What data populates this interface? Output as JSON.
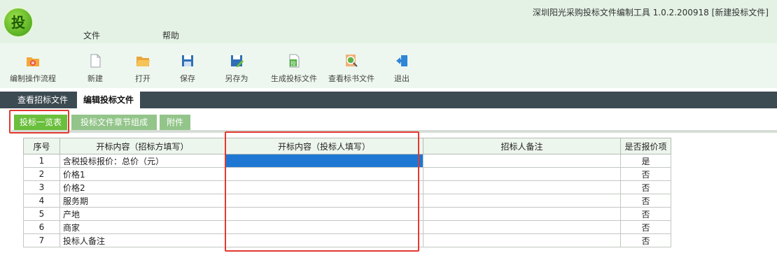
{
  "app": {
    "title": "深圳阳光采购投标文件编制工具 1.0.2.200918 [新建投标文件]",
    "logo_char": "投"
  },
  "menu": {
    "file": "文件",
    "help": "帮助"
  },
  "toolbar": [
    {
      "label": "编制操作流程",
      "icon": "workflow-icon"
    },
    {
      "label": "新建",
      "icon": "new-file-icon"
    },
    {
      "label": "打开",
      "icon": "open-folder-icon"
    },
    {
      "label": "保存",
      "icon": "save-icon"
    },
    {
      "label": "另存为",
      "icon": "save-as-icon"
    },
    {
      "label": "生成投标文件",
      "icon": "generate-bid-icon"
    },
    {
      "label": "查看标书文件",
      "icon": "view-bid-icon"
    },
    {
      "label": "退出",
      "icon": "exit-icon"
    }
  ],
  "tabs": {
    "view": "查看招标文件",
    "edit": "编辑投标文件"
  },
  "subtabs": {
    "list": "投标一览表",
    "chapters": "投标文件章节组成",
    "attachments": "附件"
  },
  "table": {
    "headers": [
      "序号",
      "开标内容（招标方填写）",
      "开标内容（投标人填写）",
      "招标人备注",
      "是否报价项"
    ],
    "rows": [
      [
        "1",
        "含税投标报价：总价（元）",
        "",
        "",
        "是"
      ],
      [
        "2",
        "价格1",
        "",
        "",
        "否"
      ],
      [
        "3",
        "价格2",
        "",
        "",
        "否"
      ],
      [
        "4",
        "服务期",
        "",
        "",
        "否"
      ],
      [
        "5",
        "产地",
        "",
        "",
        "否"
      ],
      [
        "6",
        "商家",
        "",
        "",
        "否"
      ],
      [
        "7",
        "投标人备注",
        "",
        "",
        "否"
      ]
    ]
  },
  "colors": {
    "accent": "#6abf3c",
    "highlight": "#e3382f",
    "selection": "#1e78d3",
    "tabbar": "#3c4a52"
  }
}
